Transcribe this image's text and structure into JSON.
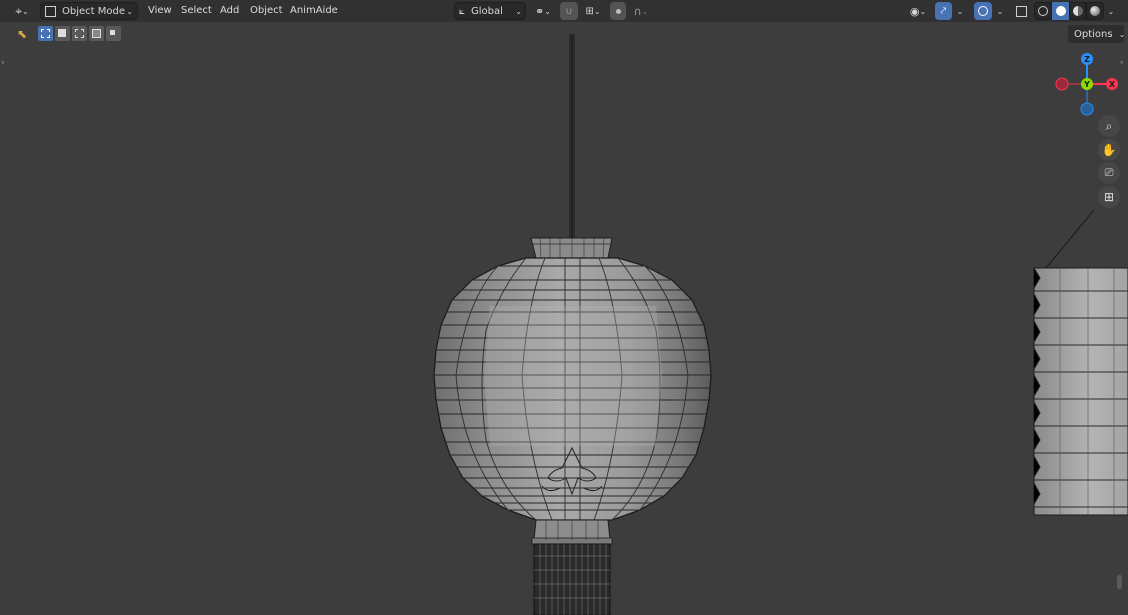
{
  "header": {
    "mode_label": "Object Mode",
    "menus": [
      "View",
      "Select",
      "Add",
      "Object",
      "AnimAide"
    ],
    "orientation_label": "Global"
  },
  "overlay": {
    "options_label": "Options"
  },
  "gizmo": {
    "axis_z": "Z",
    "axis_y": "Y",
    "axis_x": "X"
  },
  "icons": {
    "editor_type": "editor-type-icon",
    "mode": "object-mode-icon",
    "orientation": "orientation-icon",
    "pivot": "transform-pivot-icon",
    "snap": "snap-magnet-icon",
    "snap_target": "snap-increment-icon",
    "proportional": "proportional-edit-icon",
    "falloff": "falloff-curve-icon",
    "visibility": "eye-visibility-icon",
    "gizmo": "gizmo-icon",
    "overlays": "overlays-icon",
    "xray": "xray-icon",
    "shading": [
      "wireframe-shading-icon",
      "solid-shading-icon",
      "material-shading-icon",
      "rendered-shading-icon"
    ],
    "zoom": "zoom-icon",
    "pan": "hand-pan-icon",
    "camera": "camera-icon",
    "ortho": "grid-ortho-icon"
  },
  "colors": {
    "accent": "#4772b3",
    "axis_x": "#ff3352",
    "axis_y": "#8bdc00",
    "axis_z": "#2890ff",
    "viewport_bg": "#3d3d3d"
  }
}
